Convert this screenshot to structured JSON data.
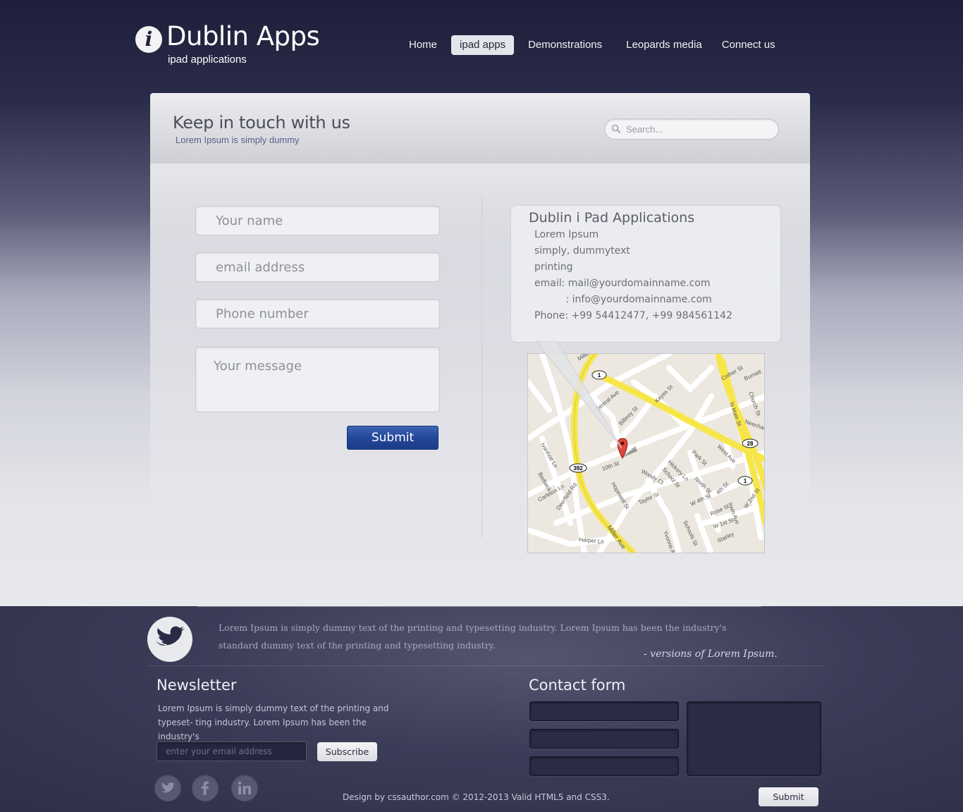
{
  "header": {
    "logo_glyph": "i",
    "title": "Dublin Apps",
    "subtitle": "ipad applications",
    "nav": [
      {
        "label": "Home",
        "active": false
      },
      {
        "label": "ipad apps",
        "active": true
      },
      {
        "label": "Demonstrations",
        "active": false
      },
      {
        "label": "Leopards media",
        "active": false
      },
      {
        "label": "Connect us",
        "active": false
      }
    ]
  },
  "page": {
    "title": "Keep in touch with us",
    "subtitle": "Lorem Ipsum is simply dummy",
    "search_placeholder": "Search..."
  },
  "form": {
    "name_placeholder": "Your name",
    "email_placeholder": "email address",
    "phone_placeholder": "Phone number",
    "message_placeholder": "Your message",
    "submit_label": "Submit"
  },
  "info": {
    "title": "Dublin i Pad Applications",
    "lines": [
      "Lorem Ipsum",
      "simply, dummytext",
      "printing",
      "email: mail@yourdomainname.com",
      "          : info@yourdomainname.com",
      "Phone: +99 54412477, +99 984561142"
    ]
  },
  "map": {
    "labels": [
      "Miller Ave",
      "Central Ave",
      "Bilbrey St",
      "Keyes St",
      "Cother St",
      "Burnett",
      "Church St",
      "N Main St",
      "Neecham",
      "West Ave",
      "Park St",
      "Hickory Ln",
      "School St",
      "North St",
      "4th St",
      "Ivanhoe Ln",
      "Bedwick",
      "Carleton Ln",
      "Deerfield Rd",
      "10th St",
      "Woody Ct",
      "Hopewell St",
      "Taylor St",
      "W 4th St",
      "Rose St",
      "W 1st St",
      "W 2nd St",
      "Schools St",
      "Harper Ln",
      "Starley",
      "Yvonne Ave",
      "Irwin Ave"
    ],
    "route_shields": [
      "1",
      "392",
      "28",
      "1"
    ]
  },
  "footer": {
    "tweet": "Lorem Ipsum is simply dummy text of the printing and typesetting industry. Lorem Ipsum has been the industry's standard dummy text  of the printing and typesetting industry.",
    "tweet_source": "- versions of Lorem Ipsum.",
    "newsletter": {
      "title": "Newsletter",
      "text": "Lorem Ipsum is simply dummy text of the printing and typeset- ting industry. Lorem Ipsum has been the industry's",
      "placeholder": "enter your email address",
      "button": "Subscribe"
    },
    "contact": {
      "title": "Contact form",
      "button": "Submit"
    },
    "social": [
      "twitter-icon",
      "facebook-icon",
      "linkedin-icon"
    ],
    "copyright": "Design by cssauthor.com © 2012-2013  Valid HTML5 and CSS3."
  }
}
